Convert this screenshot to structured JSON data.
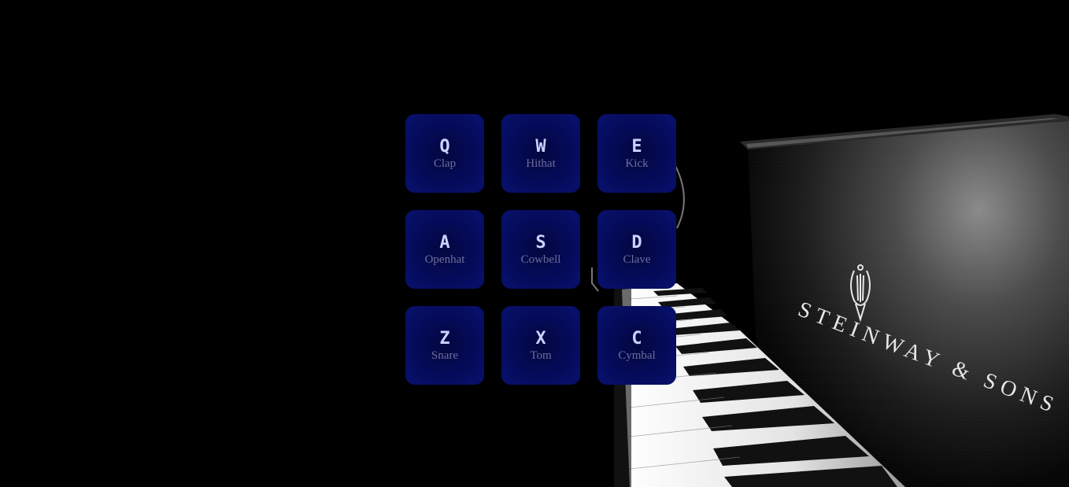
{
  "background": {
    "brand_text": "STEINWAY & SONS",
    "colors": {
      "page": "#000000",
      "pad": "#050b5a",
      "key": "#c8d4ff",
      "label": "#6c6e9a"
    }
  },
  "pads": [
    {
      "key": "Q",
      "label": "Clap"
    },
    {
      "key": "W",
      "label": "Hithat"
    },
    {
      "key": "E",
      "label": "Kick"
    },
    {
      "key": "A",
      "label": "Openhat"
    },
    {
      "key": "S",
      "label": "Cowbell"
    },
    {
      "key": "D",
      "label": "Clave"
    },
    {
      "key": "Z",
      "label": "Snare"
    },
    {
      "key": "X",
      "label": "Tom"
    },
    {
      "key": "C",
      "label": "Cymbal"
    }
  ]
}
